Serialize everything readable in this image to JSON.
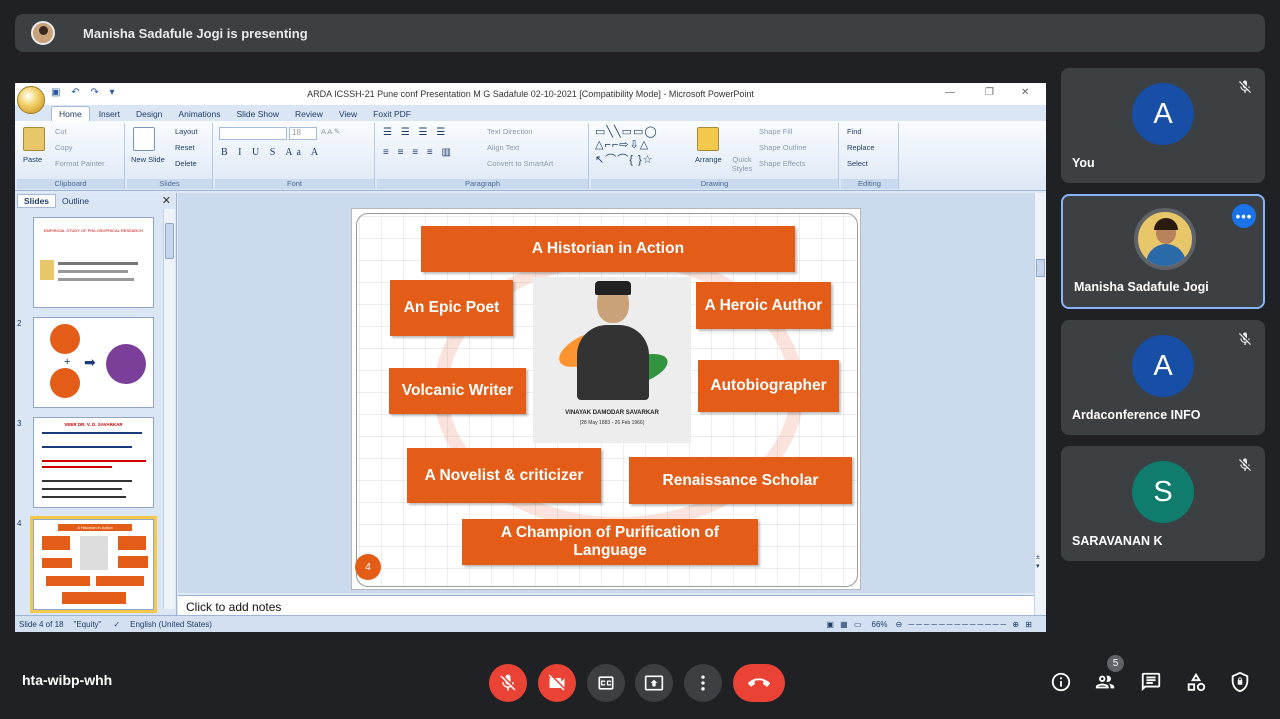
{
  "presenting_banner": {
    "text": "Manisha Sadafule Jogi is presenting"
  },
  "powerpoint": {
    "window_title": "ARDA ICSSH-21 Pune  conf Presentation M G Sadafule 02-10-2021 [Compatibility Mode] - Microsoft PowerPoint",
    "tabs": [
      "Home",
      "Insert",
      "Design",
      "Animations",
      "Slide Show",
      "Review",
      "View",
      "Foxit PDF"
    ],
    "ribbon": {
      "clipboard": {
        "label": "Clipboard",
        "paste": "Paste",
        "cut": "Cut",
        "copy": "Copy",
        "format_painter": "Format Painter"
      },
      "slides": {
        "label": "Slides",
        "new_slide": "New Slide",
        "layout": "Layout",
        "reset": "Reset",
        "delete": "Delete"
      },
      "font": {
        "label": "Font",
        "size": "18"
      },
      "paragraph": {
        "label": "Paragraph",
        "text_direction": "Text Direction",
        "align_text": "Align Text",
        "convert_smartart": "Convert to SmartArt"
      },
      "drawing": {
        "label": "Drawing",
        "arrange": "Arrange",
        "quick_styles": "Quick Styles",
        "shape_fill": "Shape Fill",
        "shape_outline": "Shape Outline",
        "shape_effects": "Shape Effects"
      },
      "editing": {
        "label": "Editing",
        "find": "Find",
        "replace": "Replace",
        "select": "Select"
      }
    },
    "panel_tabs": {
      "slides": "Slides",
      "outline": "Outline"
    },
    "thumbnails": [
      {
        "num": "",
        "title": "EMPIRICAL STUDY OF PHILOSOPHICAL RESEARCH"
      },
      {
        "num": "2",
        "title": ""
      },
      {
        "num": "3",
        "title": "VEER DR. V. D. SAVARKAR"
      },
      {
        "num": "4",
        "title": "A Historian in Action"
      }
    ],
    "slide": {
      "boxes": [
        "A Historian in Action",
        "An Epic Poet",
        "A Heroic Author",
        "Volcanic Writer",
        "Autobiographer",
        "A Novelist & criticizer",
        "Renaissance Scholar",
        "A Champion of Purification of Language"
      ],
      "portrait_caption": "VINAYAK DAMODAR SAVARKAR",
      "portrait_dates": "(28 May 1883 - 26 Feb 1966)",
      "number": "4"
    },
    "notes_placeholder": "Click to add notes",
    "status": {
      "slide_of": "Slide 4 of 18",
      "theme": "\"Equity\"",
      "language": "English (United States)",
      "zoom": "66%"
    }
  },
  "participants": [
    {
      "name": "You",
      "initial": "A",
      "color": "#174ea6",
      "muted": true,
      "has_photo": false
    },
    {
      "name": "Manisha Sadafule Jogi",
      "initial": "",
      "color": "#5f6368",
      "muted": false,
      "has_photo": true
    },
    {
      "name": "Ardaconference INFO",
      "initial": "A",
      "color": "#174ea6",
      "muted": true,
      "has_photo": false
    },
    {
      "name": "SARAVANAN K",
      "initial": "S",
      "color": "#0f7c6e",
      "muted": true,
      "has_photo": false
    }
  ],
  "meeting": {
    "code": "hta-wibp-whh",
    "participant_count": "5"
  }
}
